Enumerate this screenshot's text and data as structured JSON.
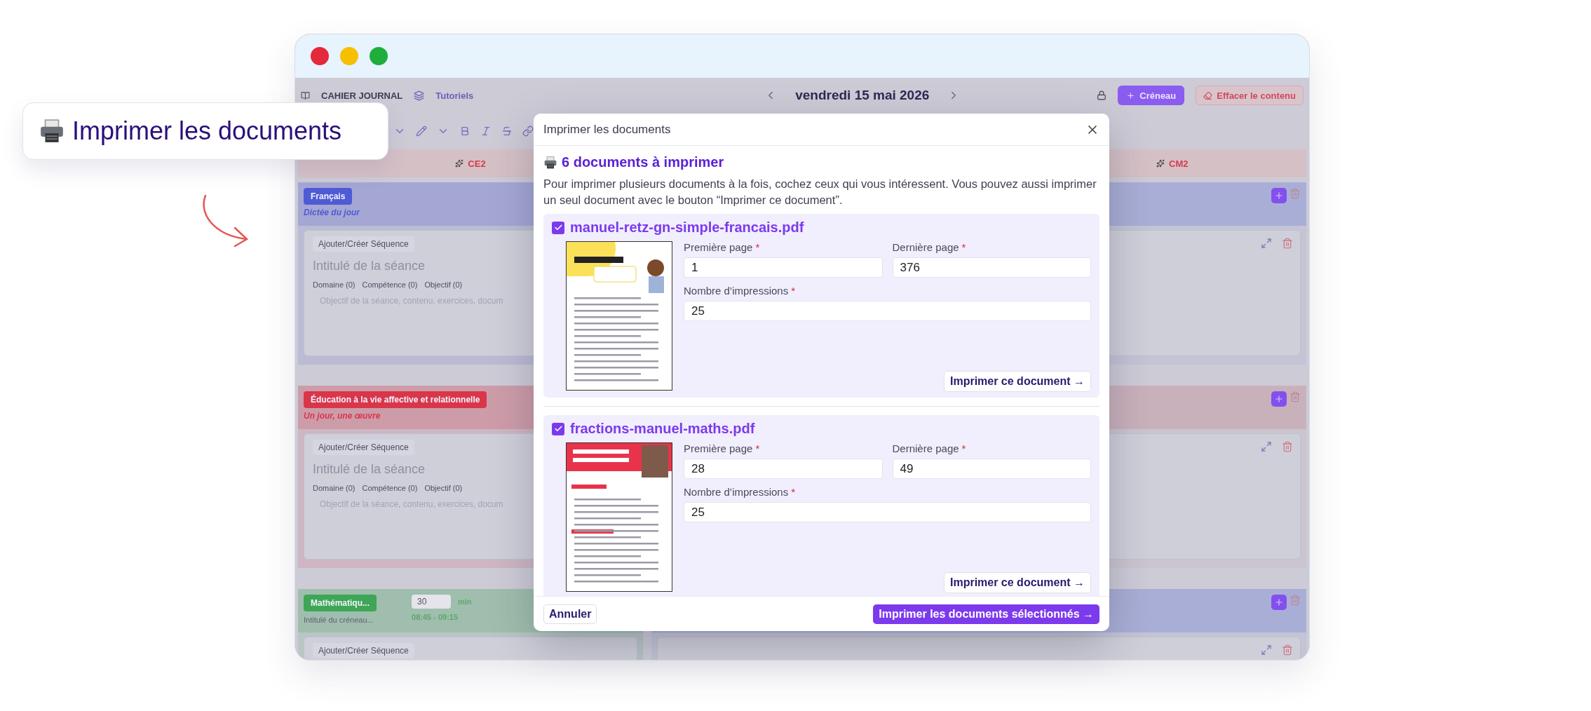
{
  "callout": {
    "title": "Imprimer les documents"
  },
  "top_bar": {
    "app_title": "CAHIER JOURNAL",
    "tutorials": "Tutoriels",
    "date": "vendredi 15 mai 2026",
    "add_slot": "Créneau",
    "clear": "Effacer le contenu"
  },
  "columns": [
    {
      "label": "CE2",
      "slots": [
        {
          "kind": "lesson",
          "subject": "Français",
          "color": "#4f5bd5",
          "subtitle": "Dictée du jour",
          "card": {
            "sequence_button": "Ajouter/Créer Séquence",
            "session_title": "Intitulé de la séance",
            "chips": [
              "Domaine (0)",
              "Compétence (0)",
              "Objectif (0)"
            ],
            "placeholder": "Objectif de la séance, contenu, exercices, docum"
          }
        },
        {
          "kind": "lesson",
          "subject": "Éducation à la vie affective et relationnelle",
          "color": "#d9364a",
          "subtitle": "Un jour, une œuvre",
          "card": {
            "sequence_button": "Ajouter/Créer Séquence",
            "session_title": "Intitulé de la séance",
            "chips": [
              "Domaine (0)",
              "Compétence (0)",
              "Objectif (0)"
            ],
            "placeholder": "Objectif de la séance, contenu, exercices, docum"
          }
        },
        {
          "kind": "timed",
          "subject": "Mathématiqu...",
          "color": "#3ea655",
          "minutes": "30",
          "minutes_unit": "min",
          "slot_title": "Intitulé du créneau...",
          "time": "08:45 - 09:15",
          "card": {
            "sequence_button": "Ajouter/Créer Séquence"
          }
        }
      ]
    },
    {
      "label": "CM2",
      "slots": [
        {
          "kind": "empty",
          "color": "#a9aed6"
        },
        {
          "kind": "empty",
          "color": "#c9b1bb"
        },
        {
          "kind": "empty",
          "color": "#a9aed6"
        }
      ]
    }
  ],
  "dialog": {
    "title": "Imprimer les documents",
    "heading": "6 documents à imprimer",
    "intro": "Pour imprimer plusieurs documents à la fois, cochez ceux qui vous intéressent. Vous pouvez aussi imprimer un seul document avec le bouton “Imprimer ce document”.",
    "documents": [
      {
        "filename": "manuel-retz-gn-simple-francais.pdf",
        "checked": true,
        "kind": "grammar",
        "fields": [
          {
            "label": "Première page",
            "required_mark": "*",
            "value": "1"
          },
          {
            "label": "Dernière page",
            "required_mark": "*",
            "value": "376"
          },
          {
            "label": "Nombre d’impressions",
            "required_mark": "*",
            "value": "25"
          }
        ],
        "print_button": "Imprimer ce document →"
      },
      {
        "filename": "fractions-manuel-maths.pdf",
        "checked": true,
        "kind": "fractions",
        "fields": [
          {
            "label": "Première page",
            "required_mark": "*",
            "value": "28"
          },
          {
            "label": "Dernière page",
            "required_mark": "*",
            "value": "49"
          },
          {
            "label": "Nombre d’impressions",
            "required_mark": "*",
            "value": "25"
          }
        ],
        "print_button": "Imprimer ce document →"
      }
    ],
    "cancel": "Annuler",
    "submit": "Imprimer les documents sélectionnés →"
  }
}
